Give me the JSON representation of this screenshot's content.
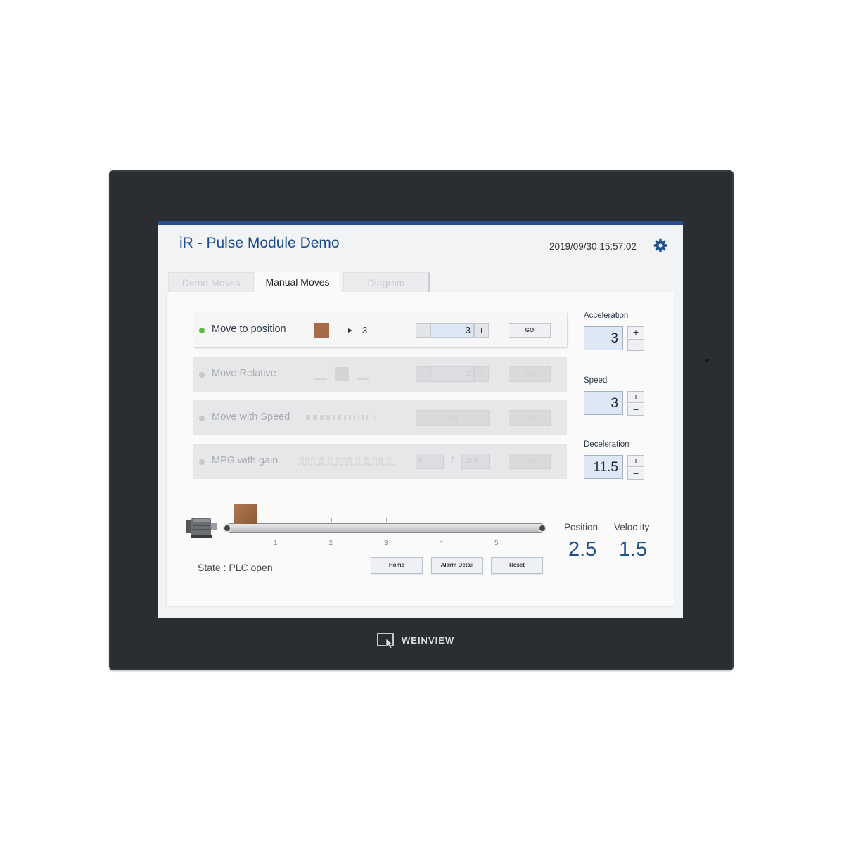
{
  "header": {
    "title": "iR - Pulse Module Demo",
    "datetime": "2019/09/30 15:57:02"
  },
  "tabs": [
    {
      "label": "Demo Moves",
      "state": "inactive"
    },
    {
      "label": "Manual Moves",
      "state": "active"
    },
    {
      "label": "Diagram",
      "state": "inactive"
    }
  ],
  "modes": [
    {
      "label": "Move to position",
      "active": true,
      "target": "3",
      "value": "3",
      "go": "GO"
    },
    {
      "label": "Move Relative",
      "active": false,
      "value": "2",
      "go": "GO"
    },
    {
      "label": "Move with Speed",
      "active": false,
      "jog": "Jog",
      "go": "GO"
    },
    {
      "label": "MPG with gain",
      "active": false,
      "gain_num": "5",
      "gain_sep": "/",
      "gain_den": "10.5",
      "go": "GO"
    }
  ],
  "stepper_symbols": {
    "minus": "−",
    "plus": "+"
  },
  "settings": {
    "acceleration": {
      "label": "Acceleration",
      "value": "3"
    },
    "speed": {
      "label": "Speed",
      "value": "3"
    },
    "deceleration": {
      "label": "Deceleration",
      "value": "11.5"
    }
  },
  "conveyor": {
    "ticks": [
      "1",
      "2",
      "3",
      "4",
      "5"
    ],
    "box_position": 0
  },
  "status": {
    "state": "State : PLC open"
  },
  "actions": {
    "home": "Home",
    "alarm_detail": "Alarm Detail",
    "reset": "Reset"
  },
  "readouts": {
    "position_label": "Position",
    "position_value": "2.5",
    "velocity_label": "Veloc ity",
    "velocity_value": "1.5"
  },
  "brand": {
    "name": "WEINVIEW"
  },
  "colors": {
    "accent": "#1e4d8c",
    "topbar": "#264e93",
    "active_dot": "#5cb84a",
    "inactive_dot": "#c8c9cb",
    "box": "#a56b46"
  },
  "icons": {
    "settings": "gear-icon",
    "motor": "motor-icon",
    "box": "box-icon"
  }
}
